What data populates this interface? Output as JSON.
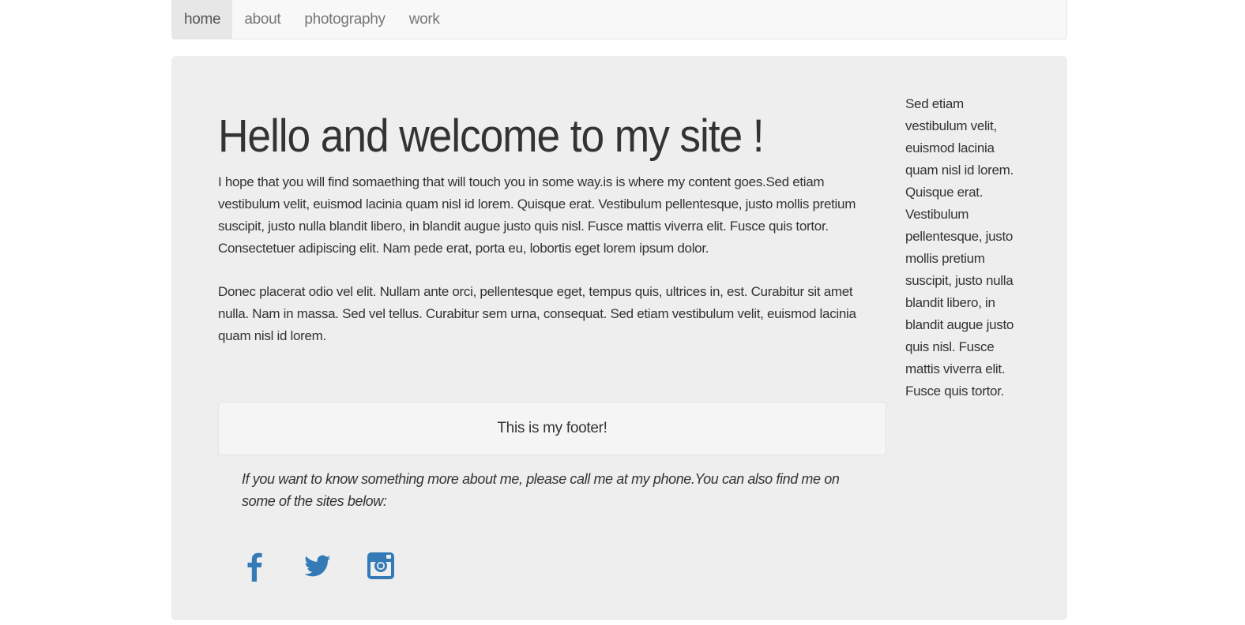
{
  "nav": {
    "items": [
      {
        "label": "home",
        "active": true
      },
      {
        "label": "about",
        "active": false
      },
      {
        "label": "photography",
        "active": false
      },
      {
        "label": "work",
        "active": false
      }
    ]
  },
  "main": {
    "headline": "Hello and welcome to my site !",
    "paragraph1": "I hope that you will find somaething that will touch you in some way.is is where my content goes.Sed etiam vestibulum velit, euismod lacinia quam nisl id lorem. Quisque erat. Vestibulum pellentesque, justo mollis pretium suscipit, justo nulla blandit libero, in blandit augue justo quis nisl. Fusce mattis viverra elit. Fusce quis tortor. Consectetuer adipiscing elit. Nam pede erat, porta eu, lobortis eget lorem ipsum dolor.",
    "paragraph2": "Donec placerat odio vel elit. Nullam ante orci, pellentesque eget, tempus quis, ultrices in, est. Curabitur sit amet nulla. Nam in massa. Sed vel tellus. Curabitur sem urna, consequat. Sed etiam vestibulum velit, euismod lacinia quam nisl id lorem."
  },
  "footer": {
    "label": "This is my footer!",
    "contact_text": "If you want to know something more about me, please call me at my phone.You can also find me on some of the sites below:"
  },
  "social": {
    "icons": [
      "facebook-icon",
      "twitter-icon",
      "instagram-icon"
    ],
    "color": "#337ab7"
  },
  "sidebar": {
    "text": "Sed etiam vestibulum velit, euismod lacinia quam nisl id lorem. Quisque erat. Vestibulum pellentesque, justo mollis pretium suscipit, justo nulla blandit libero, in blandit augue justo quis nisl. Fusce mattis viverra elit. Fusce quis tortor."
  }
}
